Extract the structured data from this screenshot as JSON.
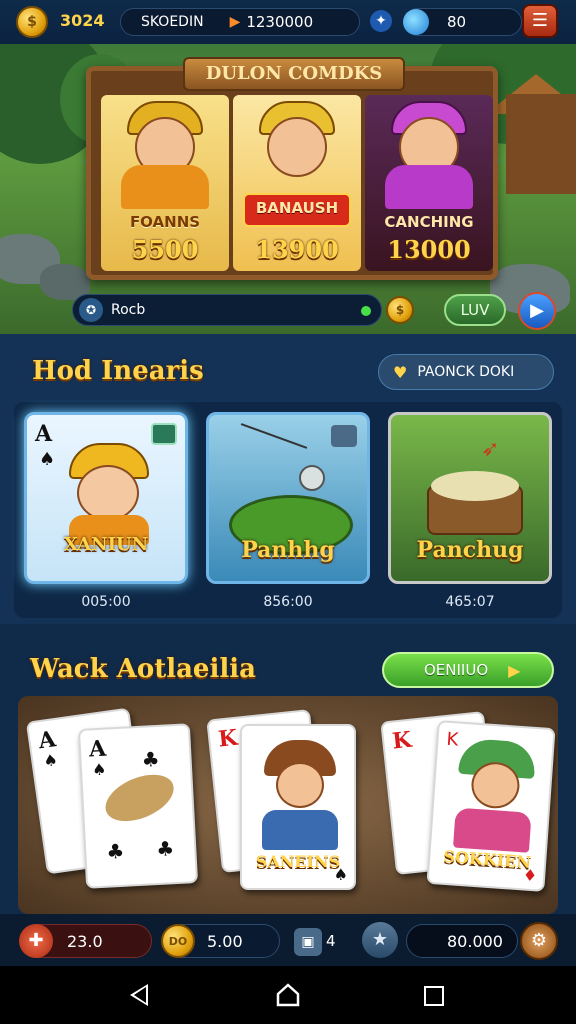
{
  "topbar": {
    "coins": "3024",
    "player_name": "SKOEDIN",
    "score": "1230000",
    "gems": "80",
    "menu_icon": "hamburger-menu-icon"
  },
  "hero": {
    "title": "DULON COMDKS",
    "panels": [
      {
        "name": "FOANNS",
        "value": "5500"
      },
      {
        "name": "BANAUSH",
        "value": "13900"
      },
      {
        "name": "CANCHING",
        "value": "13000"
      }
    ],
    "status_label": "Rocb",
    "lvl_button": "LUV"
  },
  "section1": {
    "title": "Hod Inearis",
    "button": "PAONCK DOKI",
    "cards": [
      {
        "label": "XANIUN",
        "timer": "005:00",
        "rank": "A"
      },
      {
        "label": "Panhhg",
        "timer": "856:00"
      },
      {
        "label": "Panchug",
        "timer": "465:07"
      }
    ]
  },
  "section2": {
    "title": "Wack Aotlaeilia",
    "button": "OENIIUO",
    "card_labels": [
      "SANEINS",
      "SOKKIEN"
    ],
    "ranks": [
      "A",
      "A",
      "K",
      "K"
    ]
  },
  "bottombar": {
    "health": "23.0",
    "coin_value": "5.00",
    "count": "4",
    "balance": "80.000"
  },
  "colors": {
    "gold": "#ffd44a",
    "panel_blue": "#1a3a5e",
    "green_button": "#4fc43a",
    "accent_blue": "#2a7ee0"
  }
}
